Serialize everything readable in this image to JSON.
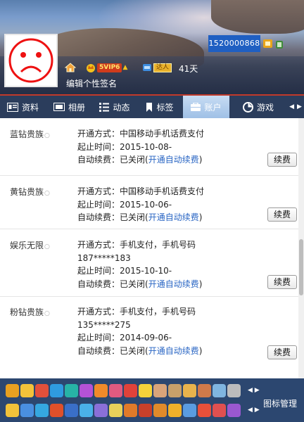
{
  "header": {
    "phone_number": "1520000868",
    "vip_level": "5VIP6",
    "daren_label": "达人",
    "days": "41天",
    "signature_prompt": "编辑个性签名"
  },
  "tabs": [
    {
      "label": "资料",
      "icon": "profile-card-icon",
      "active": false
    },
    {
      "label": "相册",
      "icon": "album-icon",
      "active": false
    },
    {
      "label": "动态",
      "icon": "feed-icon",
      "active": false
    },
    {
      "label": "标签",
      "icon": "bookmark-icon",
      "active": false
    },
    {
      "label": "账户",
      "icon": "wallet-icon",
      "active": true
    },
    {
      "label": "游戏",
      "icon": "game-icon",
      "active": false
    }
  ],
  "services": [
    {
      "name": "蓝钻贵族",
      "method": "开通方式：中国移动手机话费支付",
      "phone": "",
      "expiry": "起止时间：2015-10-08-",
      "auto_prefix": "自动续费：已关闭(",
      "auto_link": "开通自动续费",
      "auto_suffix": ")",
      "renew_label": "续费"
    },
    {
      "name": "黄钻贵族",
      "method": "开通方式：中国移动手机话费支付",
      "phone": "",
      "expiry": "起止时间：2015-10-06-",
      "auto_prefix": "自动续费：已关闭(",
      "auto_link": "开通自动续费",
      "auto_suffix": ")",
      "renew_label": "续费"
    },
    {
      "name": "娱乐无限",
      "method": "开通方式：手机支付，手机号码",
      "phone": "187*****183",
      "expiry": "起止时间：2015-10-10-",
      "auto_prefix": "自动续费：已关闭(",
      "auto_link": "开通自动续费",
      "auto_suffix": ")",
      "renew_label": "续费"
    },
    {
      "name": "粉钻贵族",
      "method": "开通方式：手机支付，手机号码",
      "phone": "135*****275",
      "expiry": "起止时间：2014-09-06-",
      "auto_prefix": "自动续费：已关闭(",
      "auto_link": "开通自动续费",
      "auto_suffix": ")",
      "renew_label": "续费"
    }
  ],
  "bottom": {
    "icon_manage_label": "图标管理"
  },
  "colors": {
    "header_accent": "#c23a2a",
    "tab_bar": "#2b3d5c",
    "active_tab": "#a9c6ea",
    "link": "#2a66c4",
    "icon_bar": "#2c4770"
  }
}
